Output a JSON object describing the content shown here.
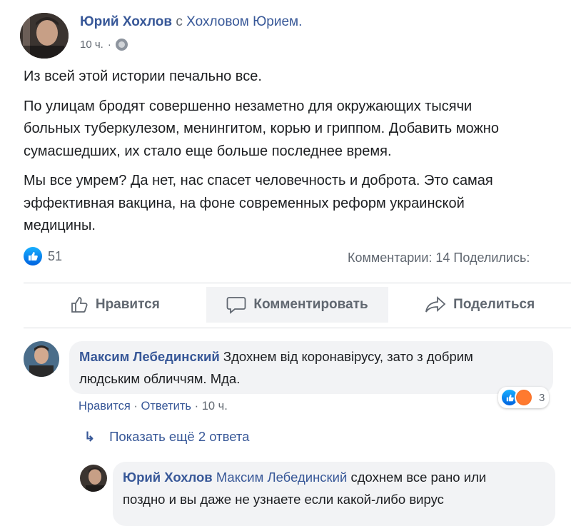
{
  "post": {
    "author": "Юрий Хохлов",
    "with_text": "с",
    "tagged": "Хохловом Юрием.",
    "time": "10 ч.",
    "paragraphs": [
      [
        "Из всей этой истории печально все."
      ],
      [
        "По улицам бродят совершенно незаметно для окружающих тысячи",
        "больных туберкулезом, менингитом, корью и гриппом. Добавить можно",
        "сумасшедших, их стало еще больше последнее время."
      ],
      [
        "Мы все умрем? Да нет, нас спасет человечность и доброта. Это самая",
        "эффективная вакцина, на фоне современных реформ украинской",
        "медицины."
      ]
    ],
    "likes_count": "51",
    "stats": "Комментарии: 14  Поделились:"
  },
  "actions": {
    "like": "Нравится",
    "comment": "Комментировать",
    "share": "Поделиться"
  },
  "comment1": {
    "author": "Максим Лебединский",
    "text_line1": "Здохнем від коронавірусу, зато з добрим",
    "text_line2": "людським обличчям. Мда.",
    "reactions_count": "3",
    "like_label": "Нравится",
    "reply_label": "Ответить",
    "separator": "·",
    "time": "10 ч."
  },
  "show_replies": "Показать ещё 2 ответа",
  "reply1": {
    "author": "Юрий Хохлов",
    "mention": "Максим Лебединский",
    "text_line1": "сдохнем все рано или",
    "text_line2": "поздно и вы даже не узнаете если какой-либо вирус"
  },
  "colors": {
    "link": "#385898",
    "secondary": "#606770",
    "bubble": "#f2f3f5",
    "like_blue": "#0062df"
  }
}
